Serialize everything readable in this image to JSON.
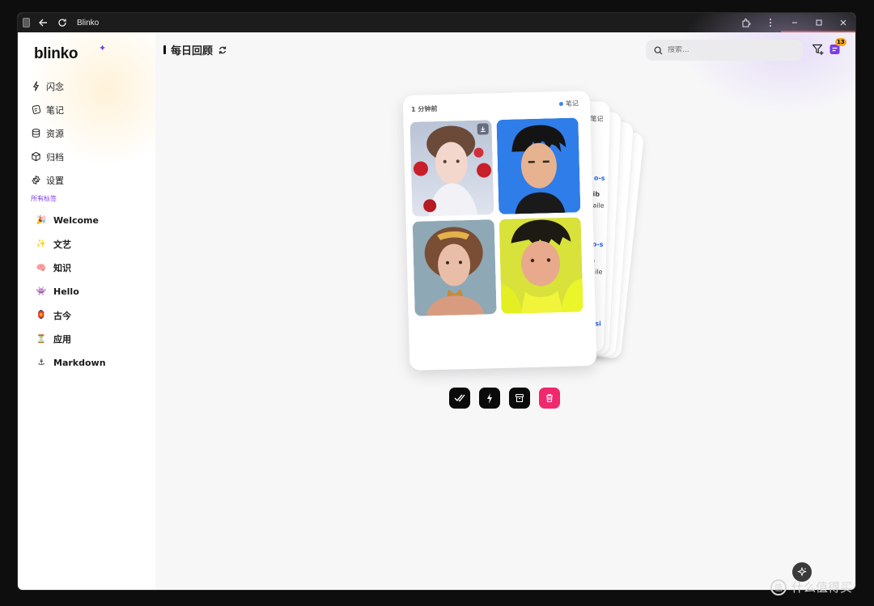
{
  "window": {
    "title": "Blinko"
  },
  "sidebar": {
    "logo": "blinko",
    "nav": [
      {
        "label": "闪念",
        "icon": "flash-icon"
      },
      {
        "label": "笔记",
        "icon": "notebook-icon"
      },
      {
        "label": "资源",
        "icon": "database-icon"
      },
      {
        "label": "归档",
        "icon": "box-icon"
      },
      {
        "label": "设置",
        "icon": "gear-icon"
      }
    ],
    "tags_header": "所有标签",
    "tags": [
      {
        "emoji": "🎉",
        "label": "Welcome"
      },
      {
        "emoji": "✨",
        "label": "文艺"
      },
      {
        "emoji": "🧠",
        "label": "知识"
      },
      {
        "emoji": "👾",
        "label": "Hello"
      },
      {
        "emoji": "🏮",
        "label": "古今"
      },
      {
        "emoji": "⏳",
        "label": "应用"
      },
      {
        "emoji": "⚓",
        "label": "Markdown"
      }
    ]
  },
  "header": {
    "title": "每日回顾",
    "search_placeholder": "搜索...",
    "notes_badge": "13"
  },
  "card": {
    "time": "1 分钟前",
    "type": "笔记",
    "back_type": "笔记",
    "back_fragments": [
      "o-s",
      "ib",
      "aile",
      "o-s",
      "o",
      "aile",
      "si"
    ]
  },
  "colors": {
    "accent": "#7c3aed",
    "delete": "#f0286e",
    "badge": "#f5a623",
    "logo_yellow": "#f5c518"
  },
  "watermark": {
    "text": "什么值得买"
  }
}
